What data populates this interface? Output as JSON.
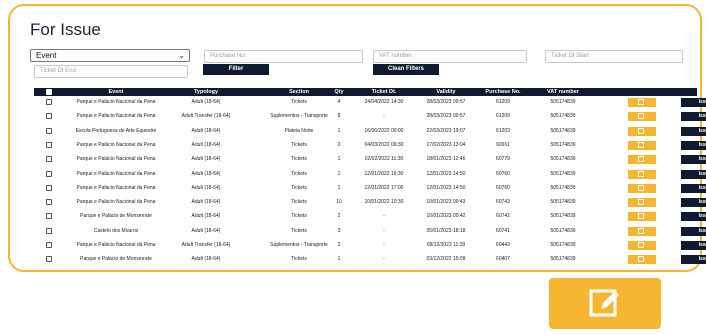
{
  "page": {
    "title": "For Issue"
  },
  "filters": {
    "event_value": "Event",
    "purchase_placeholder": "Purchase No.",
    "vat_placeholder": "VAT number",
    "start_placeholder": "Ticket Dt Start",
    "end_placeholder": "Ticket Dt End",
    "filter_label": "Filter",
    "clean_label": "Clean Filters"
  },
  "table": {
    "headers": [
      "Event",
      "Typology",
      "Section",
      "Qty",
      "Ticket Dt.",
      "Validity",
      "Purchase No.",
      "VAT number"
    ],
    "issue_label": "Issue",
    "rows": [
      [
        "Parque e Palácio Nacional da Pena",
        "Adult (18-64)",
        "Tickets",
        "4",
        "24/04/2022 14:30",
        "28/03/2023 09:57",
        "61209",
        "505174839"
      ],
      [
        "Parque e Palácio Nacional da Pena",
        "Adult Transfer (18-64)",
        "Suplementos - Transporte",
        "8",
        "-",
        "28/03/2023 09:57",
        "61209",
        "505174839"
      ],
      [
        "Escola Portuguesa de Arte Equestre",
        "Adult (18-64)",
        "Plateia Norte",
        "1",
        "16/06/2022 00:00",
        "22/03/2023 19:07",
        "61203",
        "505174839"
      ],
      [
        "Parque e Palácio Nacional da Pena",
        "Adult (18-64)",
        "Tickets",
        "2",
        "04/03/2022 09:30",
        "17/02/2023 13:04",
        "60911",
        "505174839"
      ],
      [
        "Parque e Palácio Nacional da Pena",
        "Adult (18-64)",
        "Tickets",
        "1",
        "02/02/2022 11:30",
        "18/01/2023 12:46",
        "60779",
        "505174839"
      ],
      [
        "Parque e Palácio Nacional da Pena",
        "Adult (18-64)",
        "Tickets",
        "1",
        "12/01/2022 16:30",
        "12/01/2023 14:50",
        "60760",
        "505174839"
      ],
      [
        "Parque e Palácio Nacional da Pena",
        "Adult (18-64)",
        "Tickets",
        "1",
        "12/01/2022 17:00",
        "12/01/2023 14:50",
        "60760",
        "505174839"
      ],
      [
        "Parque e Palácio Nacional da Pena",
        "Adult (18-64)",
        "Tickets",
        "10",
        "10/01/2022 10:30",
        "10/01/2023 09:43",
        "60743",
        "505174839"
      ],
      [
        "Parque e Palácio de Monserrate",
        "Adult (18-64)",
        "Tickets",
        "2",
        "-",
        "10/01/2023 09:42",
        "60742",
        "505174839"
      ],
      [
        "Castelo dos Mouros",
        "Adult (18-64)",
        "Tickets",
        "3",
        "-",
        "05/01/2023 18:18",
        "60741",
        "505174839"
      ],
      [
        "Parque e Palácio Nacional da Pena",
        "Adult Transfer (18-64)",
        "Suplementos - Transporte",
        "2",
        "-",
        "09/12/2022 11:39",
        "60443",
        "505174839"
      ],
      [
        "Parque e Palácio de Monserrate",
        "Adult (18-64)",
        "Tickets",
        "1",
        "-",
        "03/12/2022 15:09",
        "60407",
        "505174839"
      ]
    ]
  }
}
